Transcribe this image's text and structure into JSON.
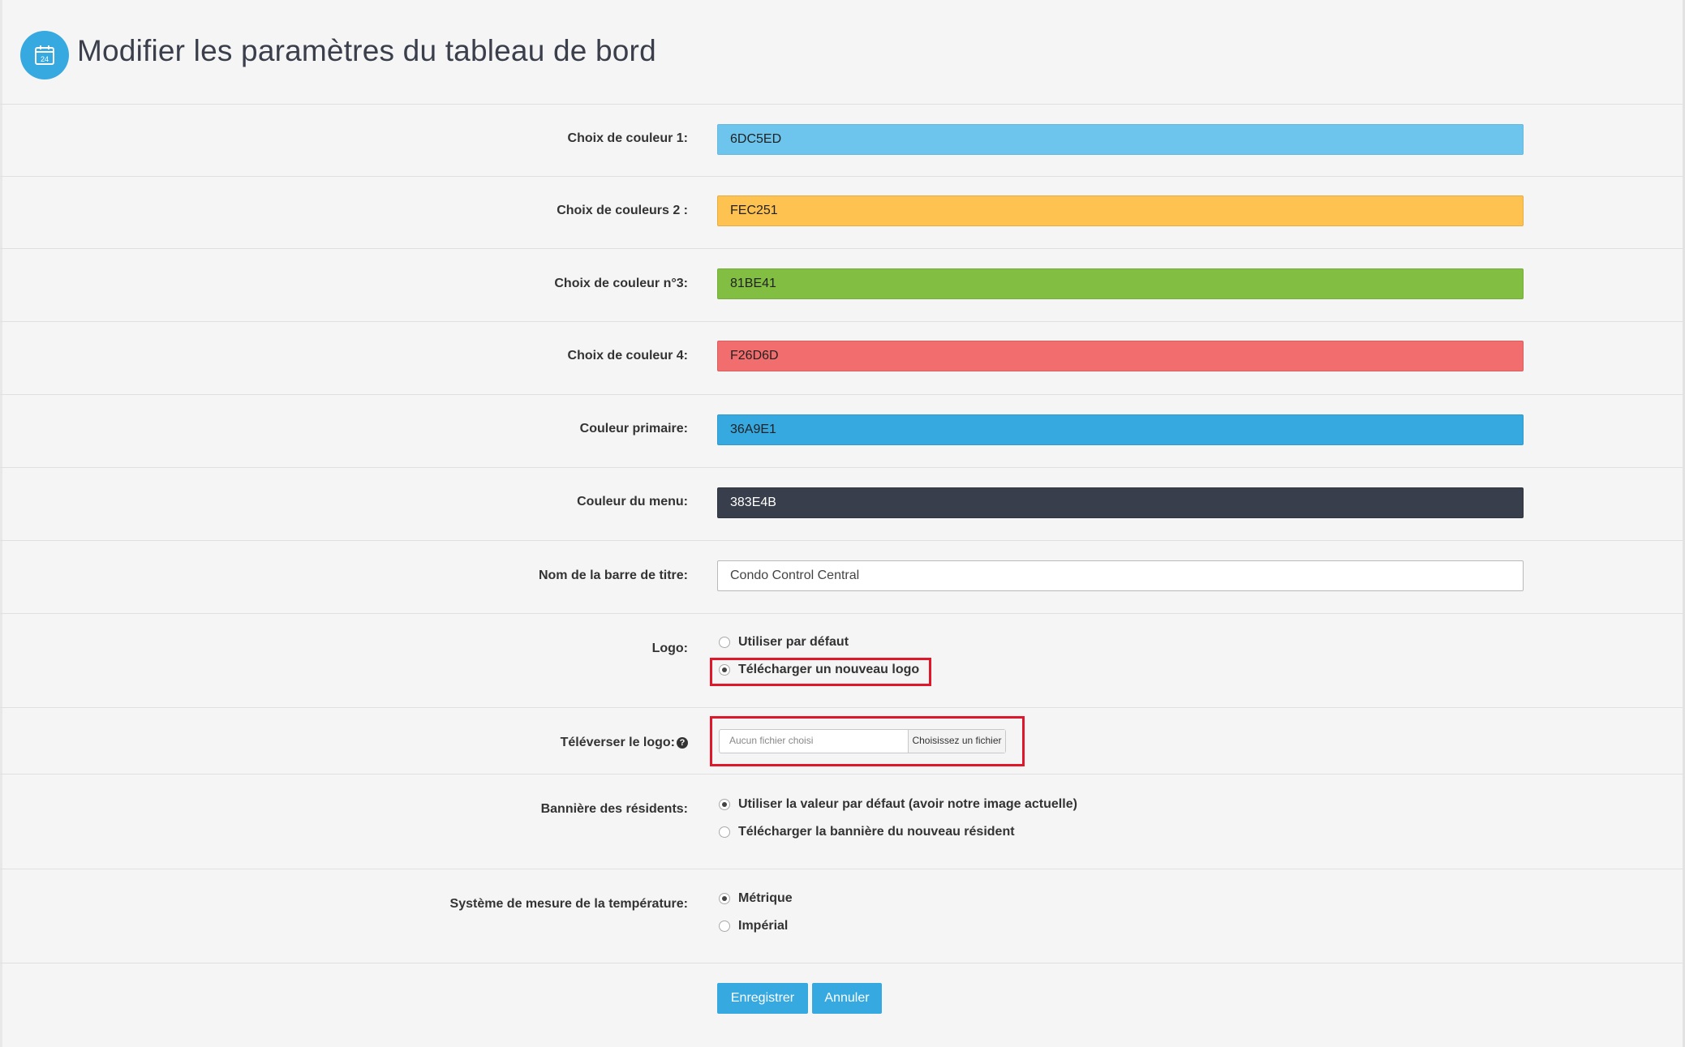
{
  "header": {
    "title": "Modifier les paramètres du tableau de bord",
    "icon": "calendar-icon",
    "icon_text": "24"
  },
  "colors": {
    "accent": "#36a9e1",
    "menu": "#383e4b"
  },
  "fields": {
    "color1": {
      "label": "Choix de couleur 1:",
      "value": "6DC5ED",
      "color": "#6dc5ed"
    },
    "color2": {
      "label": "Choix de couleurs 2 :",
      "value": "FEC251",
      "color": "#fec251"
    },
    "color3": {
      "label": "Choix de couleur n°3:",
      "value": "81BE41",
      "color": "#81be41"
    },
    "color4": {
      "label": "Choix de couleur 4:",
      "value": "F26D6D",
      "color": "#f26d6d"
    },
    "primary": {
      "label": "Couleur primaire:",
      "value": "36A9E1",
      "color": "#36a9e1"
    },
    "menu": {
      "label": "Couleur du menu:",
      "value": "383E4B",
      "color": "#383e4b"
    },
    "titlebar": {
      "label": "Nom de la barre de titre:",
      "value": "Condo Control Central"
    }
  },
  "logo": {
    "label": "Logo:",
    "options": [
      "Utiliser par défaut",
      "Télécharger un nouveau logo"
    ],
    "selected": 1
  },
  "upload": {
    "label": "Téléverser le logo:",
    "file_name": "Aucun fichier choisi",
    "button": "Choisissez un fichier"
  },
  "banner": {
    "label": "Bannière des résidents:",
    "options": [
      "Utiliser la valeur par défaut (avoir notre image actuelle)",
      "Télécharger la bannière du nouveau résident"
    ],
    "selected": 0
  },
  "temperature": {
    "label": "Système de mesure de la température:",
    "options": [
      "Métrique",
      "Impérial"
    ],
    "selected": 0
  },
  "buttons": {
    "save": "Enregistrer",
    "cancel": "Annuler"
  }
}
